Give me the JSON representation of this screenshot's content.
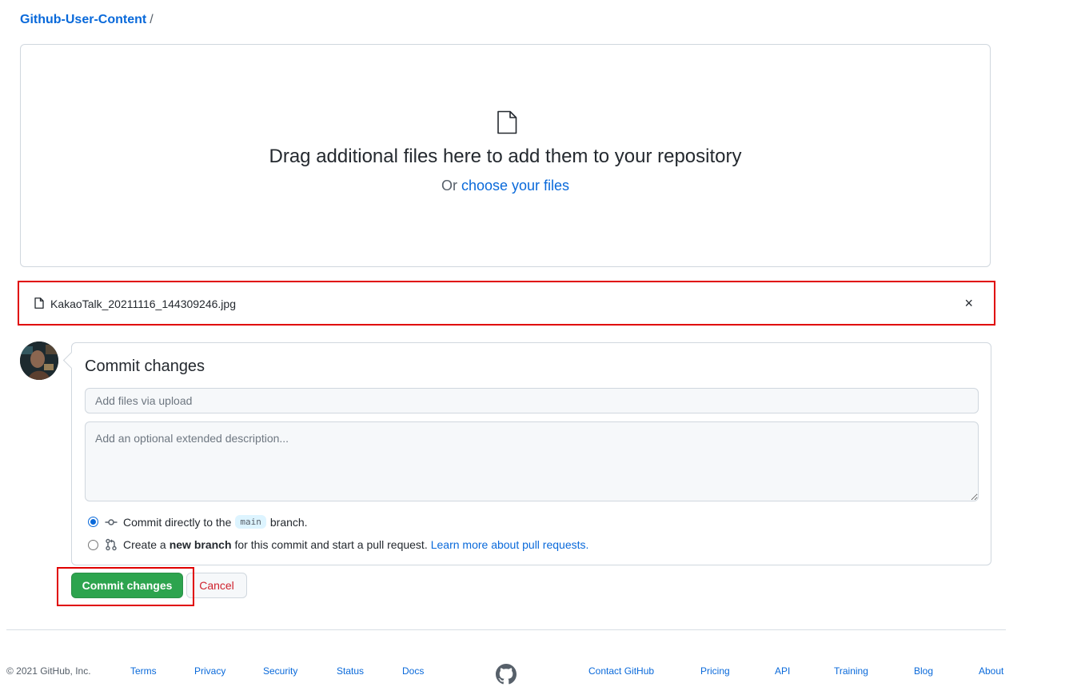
{
  "breadcrumb": {
    "repo": "Github-User-Content",
    "separator": "/"
  },
  "dropzone": {
    "icon": "file-icon",
    "headline": "Drag additional files here to add them to your repository",
    "or_text": "Or",
    "choose_link": "choose your files"
  },
  "uploaded_file": {
    "icon": "file-icon",
    "name": "KakaoTalk_20211116_144309246.jpg",
    "remove_symbol": "×"
  },
  "commit": {
    "heading": "Commit changes",
    "summary_placeholder": "Add files via upload",
    "description_placeholder": "Add an optional extended description...",
    "option_direct": {
      "prefix": "Commit directly to the",
      "branch": "main",
      "suffix": "branch.",
      "checked": true
    },
    "option_new_branch": {
      "prefix": "Create a",
      "bold": "new branch",
      "suffix": "for this commit and start a pull request.",
      "link": "Learn more about pull requests.",
      "checked": false
    },
    "submit_label": "Commit changes",
    "cancel_label": "Cancel"
  },
  "footer": {
    "copyright": "© 2021 GitHub, Inc.",
    "links_left": [
      "Terms",
      "Privacy",
      "Security",
      "Status",
      "Docs"
    ],
    "links_right": [
      "Contact GitHub",
      "Pricing",
      "API",
      "Training",
      "Blog",
      "About"
    ]
  },
  "colors": {
    "link": "#0969da",
    "primary_button": "#2da44e",
    "cancel_text": "#cf222e",
    "highlight": "#e00000"
  }
}
